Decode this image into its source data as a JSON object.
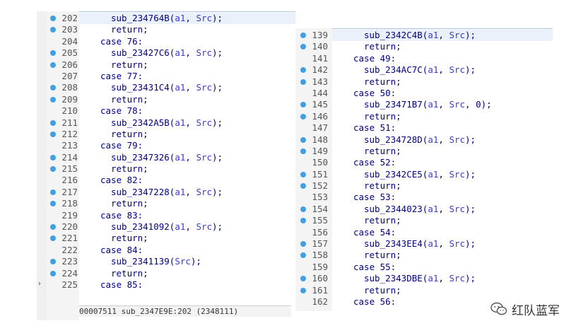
{
  "left_panel": {
    "lines": [
      {
        "num": "202",
        "dot": true,
        "current": true,
        "indent": 2,
        "text": "sub_234764B(a1, Src);"
      },
      {
        "num": "203",
        "dot": true,
        "current": false,
        "indent": 2,
        "text": "return;"
      },
      {
        "num": "204",
        "dot": false,
        "current": false,
        "indent": 1,
        "text": "case 76:"
      },
      {
        "num": "205",
        "dot": true,
        "current": false,
        "indent": 2,
        "text": "sub_23427C6(a1, Src);"
      },
      {
        "num": "206",
        "dot": true,
        "current": false,
        "indent": 2,
        "text": "return;"
      },
      {
        "num": "207",
        "dot": false,
        "current": false,
        "indent": 1,
        "text": "case 77:"
      },
      {
        "num": "208",
        "dot": true,
        "current": false,
        "indent": 2,
        "text": "sub_23431C4(a1, Src);"
      },
      {
        "num": "209",
        "dot": true,
        "current": false,
        "indent": 2,
        "text": "return;"
      },
      {
        "num": "210",
        "dot": false,
        "current": false,
        "indent": 1,
        "text": "case 78:"
      },
      {
        "num": "211",
        "dot": true,
        "current": false,
        "indent": 2,
        "text": "sub_2342A5B(a1, Src);"
      },
      {
        "num": "212",
        "dot": true,
        "current": false,
        "indent": 2,
        "text": "return;"
      },
      {
        "num": "213",
        "dot": false,
        "current": false,
        "indent": 1,
        "text": "case 79:"
      },
      {
        "num": "214",
        "dot": true,
        "current": false,
        "indent": 2,
        "text": "sub_2347326(a1, Src);"
      },
      {
        "num": "215",
        "dot": true,
        "current": false,
        "indent": 2,
        "text": "return;"
      },
      {
        "num": "216",
        "dot": false,
        "current": false,
        "indent": 1,
        "text": "case 82:"
      },
      {
        "num": "217",
        "dot": true,
        "current": false,
        "indent": 2,
        "text": "sub_2347228(a1, Src);"
      },
      {
        "num": "218",
        "dot": true,
        "current": false,
        "indent": 2,
        "text": "return;"
      },
      {
        "num": "219",
        "dot": false,
        "current": false,
        "indent": 1,
        "text": "case 83:"
      },
      {
        "num": "220",
        "dot": true,
        "current": false,
        "indent": 2,
        "text": "sub_2341092(a1, Src);"
      },
      {
        "num": "221",
        "dot": true,
        "current": false,
        "indent": 2,
        "text": "return;"
      },
      {
        "num": "222",
        "dot": false,
        "current": false,
        "indent": 1,
        "text": "case 84:"
      },
      {
        "num": "223",
        "dot": true,
        "current": false,
        "indent": 2,
        "text": "sub_2341139(Src);"
      },
      {
        "num": "224",
        "dot": true,
        "current": false,
        "indent": 2,
        "text": "return;"
      },
      {
        "num": "225",
        "dot": false,
        "current": false,
        "indent": 1,
        "text": "case 85:"
      }
    ],
    "status": "00007511 sub_2347E9E:202 (2348111)"
  },
  "right_panel": {
    "lines": [
      {
        "num": "139",
        "dot": true,
        "current": true,
        "indent": 2,
        "text": "sub_2342C4B(a1, Src);"
      },
      {
        "num": "140",
        "dot": true,
        "current": false,
        "indent": 2,
        "text": "return;"
      },
      {
        "num": "141",
        "dot": false,
        "current": false,
        "indent": 1,
        "text": "case 49:"
      },
      {
        "num": "142",
        "dot": true,
        "current": false,
        "indent": 2,
        "text": "sub_234AC7C(a1, Src);"
      },
      {
        "num": "143",
        "dot": true,
        "current": false,
        "indent": 2,
        "text": "return;"
      },
      {
        "num": "144",
        "dot": false,
        "current": false,
        "indent": 1,
        "text": "case 50:"
      },
      {
        "num": "145",
        "dot": true,
        "current": false,
        "indent": 2,
        "text": "sub_23471B7(a1, Src, 0);"
      },
      {
        "num": "146",
        "dot": true,
        "current": false,
        "indent": 2,
        "text": "return;"
      },
      {
        "num": "147",
        "dot": false,
        "current": false,
        "indent": 1,
        "text": "case 51:"
      },
      {
        "num": "148",
        "dot": true,
        "current": false,
        "indent": 2,
        "text": "sub_234728D(a1, Src);"
      },
      {
        "num": "149",
        "dot": true,
        "current": false,
        "indent": 2,
        "text": "return;"
      },
      {
        "num": "150",
        "dot": false,
        "current": false,
        "indent": 1,
        "text": "case 52:"
      },
      {
        "num": "151",
        "dot": true,
        "current": false,
        "indent": 2,
        "text": "sub_2342CE5(a1, Src);"
      },
      {
        "num": "152",
        "dot": true,
        "current": false,
        "indent": 2,
        "text": "return;"
      },
      {
        "num": "153",
        "dot": false,
        "current": false,
        "indent": 1,
        "text": "case 53:"
      },
      {
        "num": "154",
        "dot": true,
        "current": false,
        "indent": 2,
        "text": "sub_2344023(a1, Src);"
      },
      {
        "num": "155",
        "dot": true,
        "current": false,
        "indent": 2,
        "text": "return;"
      },
      {
        "num": "156",
        "dot": false,
        "current": false,
        "indent": 1,
        "text": "case 54:"
      },
      {
        "num": "157",
        "dot": true,
        "current": false,
        "indent": 2,
        "text": "sub_2343EE4(a1, Src);"
      },
      {
        "num": "158",
        "dot": true,
        "current": false,
        "indent": 2,
        "text": "return;"
      },
      {
        "num": "159",
        "dot": false,
        "current": false,
        "indent": 1,
        "text": "case 55:"
      },
      {
        "num": "160",
        "dot": true,
        "current": false,
        "indent": 2,
        "text": "sub_2343DBE(a1, Src);"
      },
      {
        "num": "161",
        "dot": true,
        "current": false,
        "indent": 2,
        "text": "return;"
      },
      {
        "num": "162",
        "dot": false,
        "current": false,
        "indent": 1,
        "text": "case 56:"
      }
    ]
  },
  "watermark": {
    "text": "红队蓝军",
    "icon": "wechat-logo-icon"
  },
  "colors": {
    "breakpoint_dot": "#3f9fe6",
    "code_text": "#000080",
    "variable_text": "#3a3acf",
    "line_number": "#555555",
    "current_line_bg": "#eaf1fb"
  }
}
